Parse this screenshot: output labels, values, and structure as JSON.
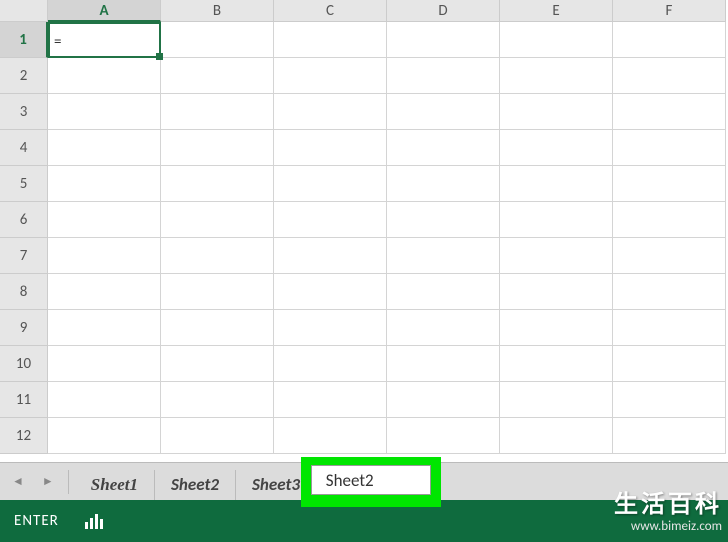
{
  "columns": [
    "A",
    "B",
    "C",
    "D",
    "E",
    "F"
  ],
  "active_column": "A",
  "rows": [
    1,
    2,
    3,
    4,
    5,
    6,
    7,
    8,
    9,
    10,
    11,
    12
  ],
  "active_row": 1,
  "active_cell_value": "=",
  "sheets": {
    "s1": "Sheet1",
    "s2": "Sheet2",
    "s3": "Sheet3"
  },
  "highlighted_sheet": "Sheet2",
  "nav": {
    "prev": "◄",
    "next": "►"
  },
  "add_sheet": "+",
  "status": {
    "mode": "ENTER"
  },
  "watermark": {
    "line1": "生活百科",
    "line2": "www.bimeiz.com"
  }
}
